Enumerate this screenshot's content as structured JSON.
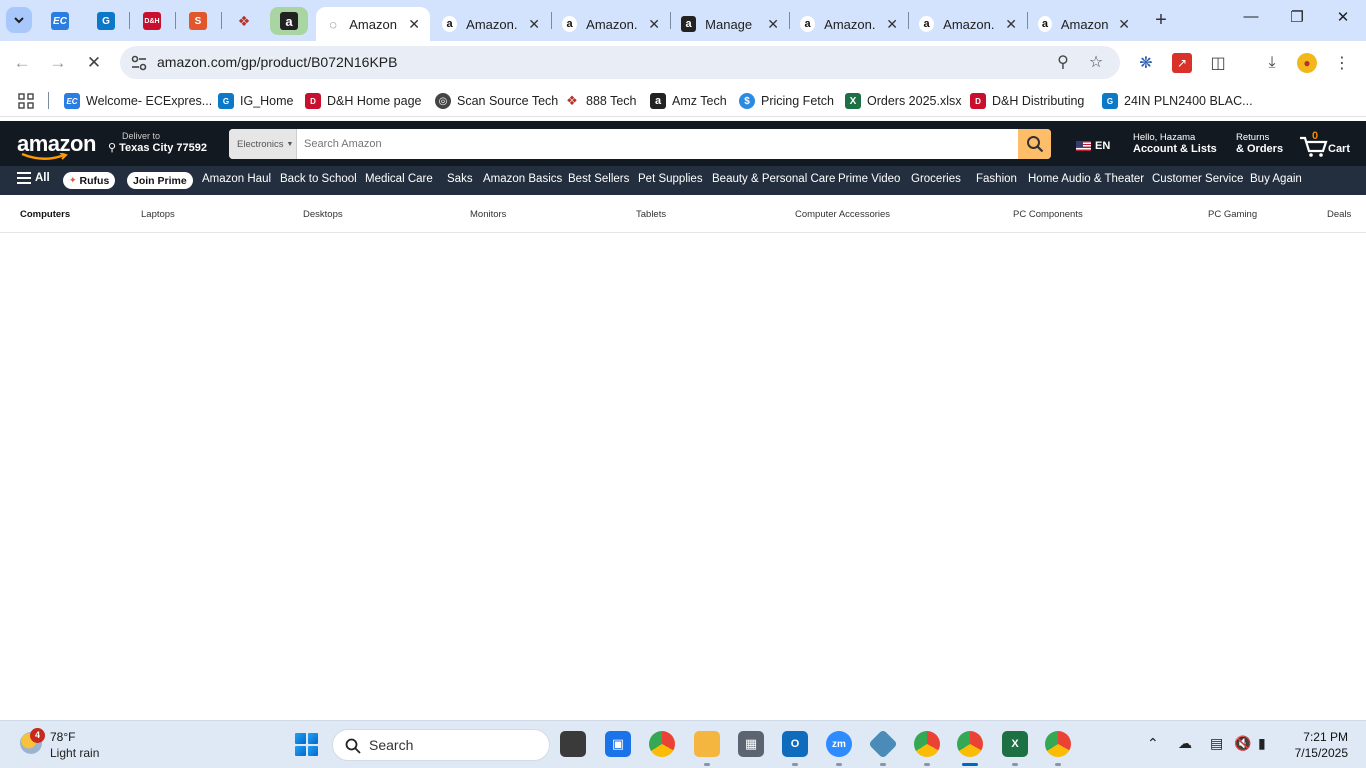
{
  "browser": {
    "pinned_tabs": [
      {
        "icon": "ecexpress-icon",
        "color": "#2a7de1",
        "glyph": "EC"
      },
      {
        "icon": "ig-icon",
        "color": "#0b78c8",
        "glyph": "G"
      },
      {
        "icon": "dh-icon",
        "color": "#c8102e",
        "glyph": "D&H"
      },
      {
        "icon": "scansource-icon",
        "color": "#e2562b",
        "glyph": "S"
      },
      {
        "icon": "888tech-icon",
        "color": "#b4322a",
        "glyph": "8"
      },
      {
        "icon": "amazon-icon",
        "color": "#222222",
        "glyph": "a"
      }
    ],
    "tabs": [
      {
        "title": "Amazon.com",
        "active": true,
        "loading": true
      },
      {
        "title": "Amazon.com",
        "active": false
      },
      {
        "title": "Amazon.com",
        "active": false
      },
      {
        "title": "Manage",
        "active": false
      },
      {
        "title": "Amazon.com",
        "active": false
      },
      {
        "title": "Amazon.com",
        "active": false
      },
      {
        "title": "Amazon.com",
        "active": false
      }
    ],
    "url": "amazon.com/gp/product/B072N16KPB",
    "bookmarks": [
      {
        "label": "Welcome- ECExpres...",
        "icon": "ecexpress-icon",
        "color": "#2a7de1",
        "glyph": "EC"
      },
      {
        "label": "IG_Home",
        "icon": "ig-icon",
        "color": "#0b78c8",
        "glyph": "G"
      },
      {
        "label": "D&H Home page",
        "icon": "dh-icon",
        "color": "#c8102e",
        "glyph": "D"
      },
      {
        "label": "Scan Source Tech",
        "icon": "globe-icon",
        "color": "#444444",
        "glyph": "◎"
      },
      {
        "label": "888 Tech",
        "icon": "888tech-icon",
        "color": "#b4322a",
        "glyph": "8"
      },
      {
        "label": "Amz Tech",
        "icon": "amazon-icon",
        "color": "#222222",
        "glyph": "a"
      },
      {
        "label": "Pricing Fetch",
        "icon": "dollar-icon",
        "color": "#2b8ae2",
        "glyph": "$"
      },
      {
        "label": "Orders 2025.xlsx",
        "icon": "excel-icon",
        "color": "#1d7044",
        "glyph": "X"
      },
      {
        "label": "D&H Distributing",
        "icon": "dh-icon",
        "color": "#c8102e",
        "glyph": "D"
      },
      {
        "label": "24IN PLN2400 BLAC...",
        "icon": "ig-icon",
        "color": "#0b78c8",
        "glyph": "G"
      }
    ]
  },
  "amazon": {
    "logo": "amazon",
    "deliver_to_label": "Deliver to",
    "deliver_to_location": "Texas City 77592",
    "search_category": "Electronics",
    "search_placeholder": "Search Amazon",
    "language": "EN",
    "account_greeting": "Hello, Hazama",
    "account_label": "Account & Lists",
    "returns_label": "Returns",
    "orders_label": "& Orders",
    "cart_count": "0",
    "cart_label": "Cart",
    "accent_color": "#febd69",
    "subnav": {
      "all": "All",
      "rufus": "Rufus",
      "join_prime": "Join Prime",
      "items": [
        "Amazon Haul",
        "Back to School",
        "Medical Care",
        "Saks",
        "Amazon Basics",
        "Best Sellers",
        "Pet Supplies",
        "Beauty & Personal Care",
        "Prime Video",
        "Groceries",
        "Fashion",
        "Home Audio & Theater",
        "Customer Service",
        "Buy Again"
      ]
    },
    "categories": [
      "Computers",
      "Laptops",
      "Desktops",
      "Monitors",
      "Tablets",
      "Computer Accessories",
      "PC Components",
      "PC Gaming",
      "Deals"
    ]
  },
  "taskbar": {
    "weather_badge": "4",
    "weather_temp": "78°F",
    "weather_desc": "Light rain",
    "search_label": "Search",
    "time": "7:21 PM",
    "date": "7/15/2025"
  }
}
